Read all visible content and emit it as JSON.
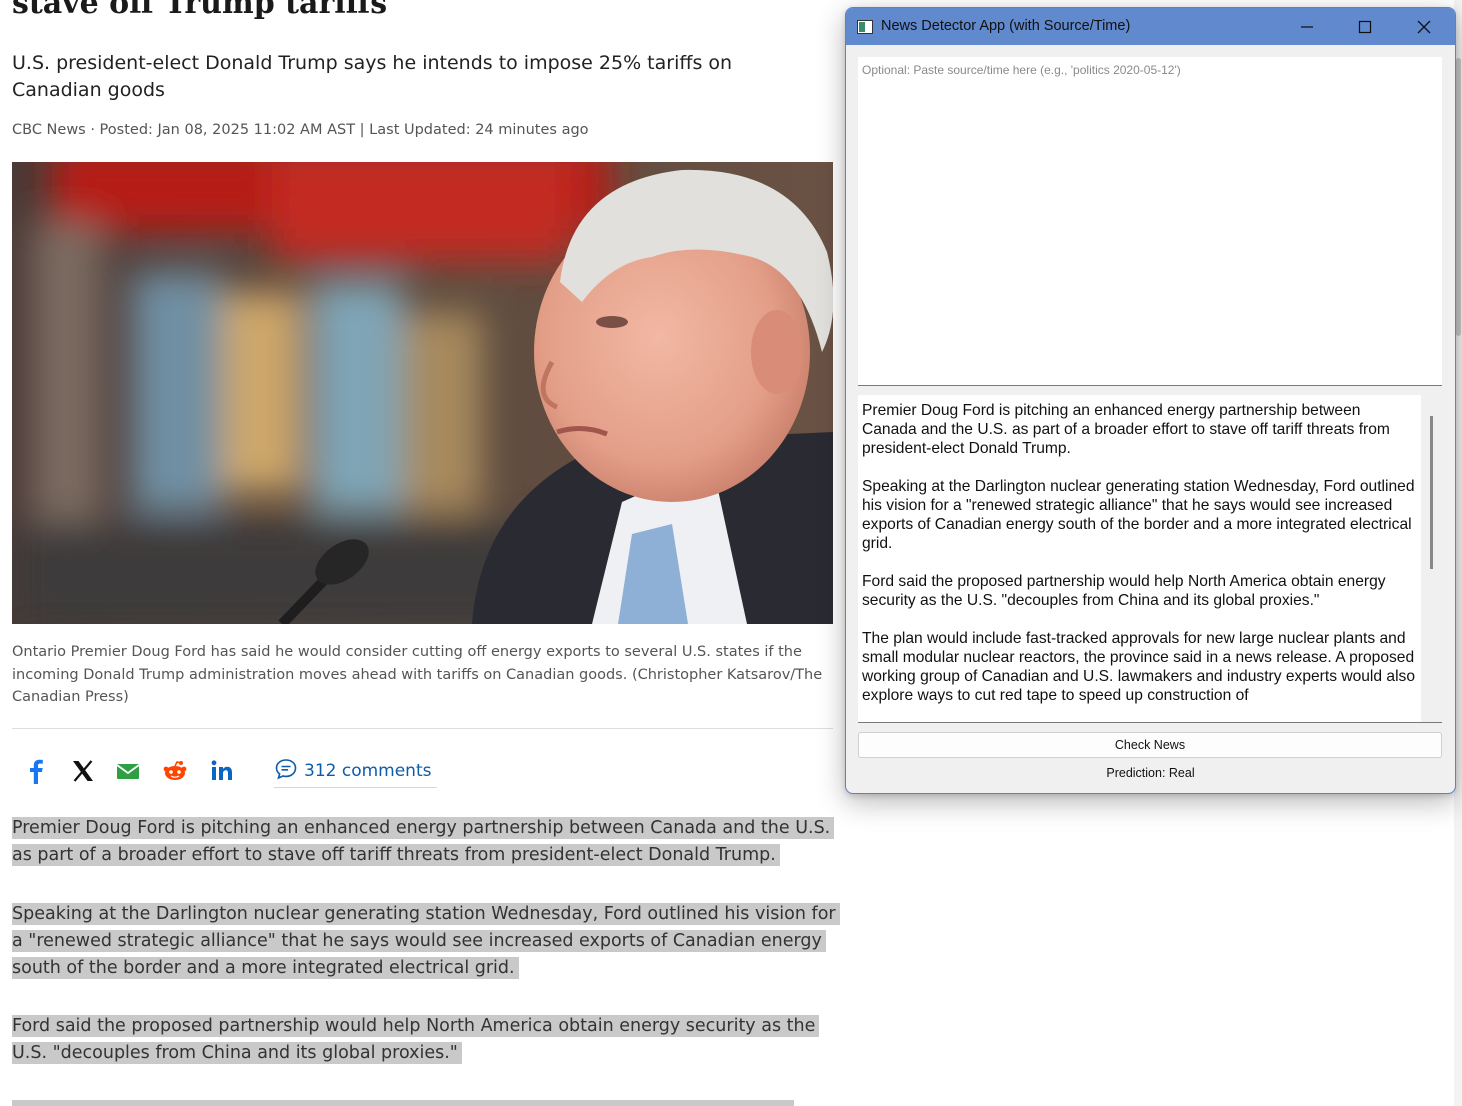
{
  "article": {
    "headline": "stave off Trump tariffs",
    "deck": "U.S. president-elect Donald Trump says he intends to impose 25% tariffs on Canadian goods",
    "byline": "CBC News · Posted: Jan 08, 2025 11:02 AM AST | Last Updated: 24 minutes ago",
    "caption": "Ontario Premier Doug Ford has said he would consider cutting off energy exports to several U.S. states if the incoming Donald Trump administration moves ahead with tariffs on Canadian goods. (Christopher Katsarov/The Canadian Press)",
    "share_icons": [
      "facebook-icon",
      "x-icon",
      "email-icon",
      "reddit-icon",
      "linkedin-icon"
    ],
    "comments_label": "312 comments",
    "paragraphs": [
      "Premier Doug Ford is pitching an enhanced energy partnership between Canada and the U.S. as part of a broader effort to stave off tariff threats from president-elect Donald Trump.",
      "Speaking at the Darlington nuclear generating station Wednesday, Ford outlined his vision for a \"renewed strategic alliance\" that he says would see increased exports of Canadian energy south of the border and a more integrated electrical grid.",
      "Ford said the proposed partnership would help North America obtain energy security as the U.S. \"decouples from China and its global proxies.\""
    ]
  },
  "app": {
    "title": "News Detector App (with Source/Time)",
    "source_placeholder": "Optional: Paste source/time here (e.g., 'politics 2020-05-12')",
    "text_paragraphs": [
      "Premier Doug Ford is pitching an enhanced energy partnership between Canada and the U.S. as part of a broader effort to stave off tariff threats from president-elect Donald Trump.",
      "Speaking at the Darlington nuclear generating station Wednesday, Ford outlined his vision for a \"renewed strategic alliance\" that he says would see increased exports of Canadian energy south of the border and a more integrated electrical grid.",
      "Ford said the proposed partnership would help North America obtain energy security as the U.S. \"decouples from China and its global proxies.\"",
      "The plan would include fast-tracked approvals for new large nuclear plants and small modular nuclear reactors, the province said in a news release. A proposed working group of Canadian and U.S. lawmakers and industry experts would also explore ways to cut red tape to speed up construction of"
    ],
    "check_button": "Check News",
    "prediction": "Prediction: Real",
    "colors": {
      "titlebar": "#6089ce",
      "border": "#5c82c6"
    }
  }
}
